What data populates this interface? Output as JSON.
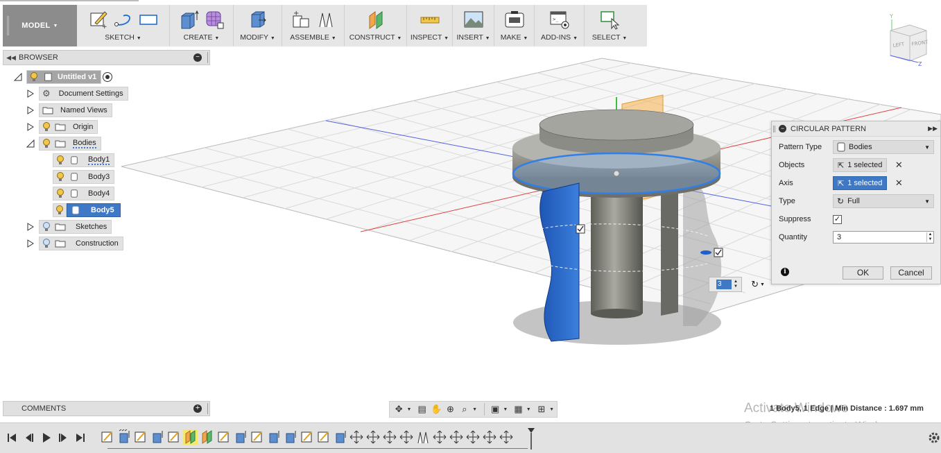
{
  "toolbar": {
    "workspace": "MODEL",
    "groups": [
      {
        "label": "SKETCH"
      },
      {
        "label": "CREATE"
      },
      {
        "label": "MODIFY"
      },
      {
        "label": "ASSEMBLE"
      },
      {
        "label": "CONSTRUCT"
      },
      {
        "label": "INSPECT"
      },
      {
        "label": "INSERT"
      },
      {
        "label": "MAKE"
      },
      {
        "label": "ADD-INS"
      },
      {
        "label": "SELECT"
      }
    ]
  },
  "browser": {
    "title": "BROWSER",
    "root": "Untitled v1",
    "items": [
      {
        "label": "Document Settings"
      },
      {
        "label": "Named Views"
      },
      {
        "label": "Origin"
      },
      {
        "label": "Bodies"
      },
      {
        "label": "Body1"
      },
      {
        "label": "Body3"
      },
      {
        "label": "Body4"
      },
      {
        "label": "Body5"
      },
      {
        "label": "Sketches"
      },
      {
        "label": "Construction"
      }
    ]
  },
  "comments": {
    "title": "COMMENTS"
  },
  "viewcube": {
    "left": "LEFT",
    "front": "FRONT",
    "y_axis": "Y",
    "z_axis": "Z"
  },
  "dialog": {
    "title": "CIRCULAR PATTERN",
    "pattern_type_label": "Pattern Type",
    "pattern_type_value": "Bodies",
    "objects_label": "Objects",
    "objects_value": "1 selected",
    "axis_label": "Axis",
    "axis_value": "1 selected",
    "type_label": "Type",
    "type_value": "Full",
    "suppress_label": "Suppress",
    "suppress_checked": true,
    "quantity_label": "Quantity",
    "quantity_value": "3",
    "ok_label": "OK",
    "cancel_label": "Cancel"
  },
  "canvas_widget": {
    "quantity": "3"
  },
  "status": {
    "selection": "1 Body5, 1 Edge | Min Distance : 1.697 mm",
    "watermark_line1": "Activate Windows",
    "watermark_line2": "Go to Settings to activate Windows."
  },
  "colors": {
    "accent": "#3f79c5",
    "body_blue": "#2f6fd0",
    "axis_red": "#e04040",
    "axis_blue": "#5060e0",
    "plane_orange": "#f5b04a"
  }
}
